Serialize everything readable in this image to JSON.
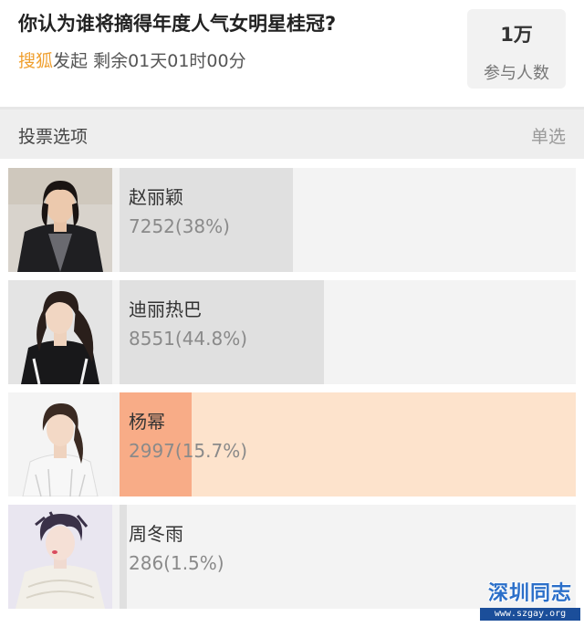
{
  "poll": {
    "question": "你认为谁将摘得年度人气女明星桂冠?",
    "initiator": "搜狐",
    "initiator_suffix": "发起",
    "remaining": "剩余01天01时00分",
    "participants_count": "1万",
    "participants_label": "参与人数"
  },
  "vote_section": {
    "label": "投票选项",
    "mode": "单选"
  },
  "options": [
    {
      "name": "赵丽颖",
      "votes_text": "7252(38%)",
      "share": 0.38,
      "selected": false,
      "photo_icon": "portrait-photo"
    },
    {
      "name": "迪丽热巴",
      "votes_text": "8551(44.8%)",
      "share": 0.448,
      "selected": false,
      "photo_icon": "portrait-photo"
    },
    {
      "name": "杨幂",
      "votes_text": "2997(15.7%)",
      "share": 0.157,
      "selected": true,
      "photo_icon": "portrait-photo"
    },
    {
      "name": "周冬雨",
      "votes_text": "286(1.5%)",
      "share": 0.015,
      "selected": false,
      "photo_icon": "portrait-photo"
    }
  ],
  "watermark": {
    "title": "深圳同志",
    "url": "www.szgay.org"
  },
  "colors": {
    "brand": "#f0a030",
    "selected_fill": "#f8ac87",
    "selected_track": "#fde3cc",
    "bar_fill": "#e0e0e0",
    "bar_track": "#f3f3f3"
  }
}
